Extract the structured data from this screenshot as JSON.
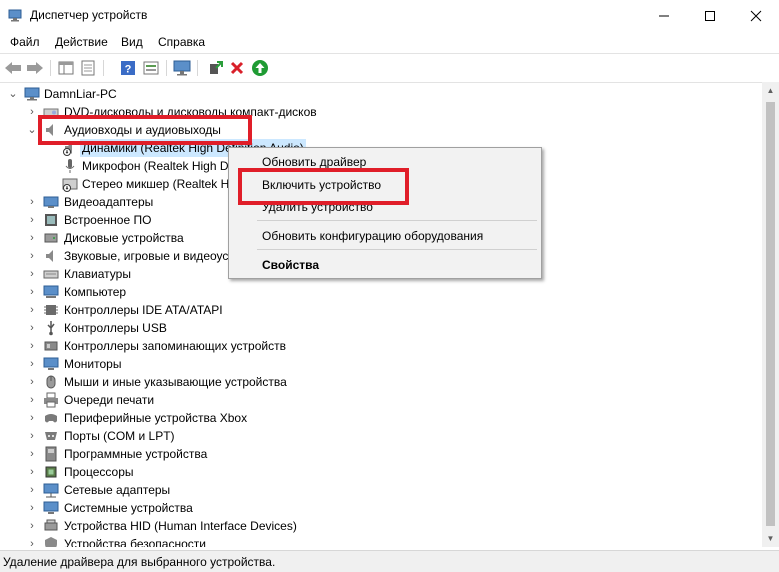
{
  "window": {
    "title": "Диспетчер устройств",
    "controls": [
      "minimize-icon",
      "maximize-icon",
      "close-icon"
    ]
  },
  "menu": [
    "Файл",
    "Действие",
    "Вид",
    "Справка"
  ],
  "toolbar": {
    "icons": [
      "back-arrow-icon",
      "forward-arrow-icon",
      "device-manager-view-icon",
      "properties-icon",
      "help-icon",
      "resources-view-icon",
      "scan-hardware-icon",
      "update-driver-icon",
      "remove-device-icon",
      "enable-device-icon"
    ]
  },
  "tree": {
    "root": "DamnLiar-PC",
    "rows": [
      {
        "label": "DVD-дисководы и дисководы компакт-дисков",
        "expander": "›",
        "icon": "dvd-drive-icon"
      },
      {
        "label": "Аудиовходы и аудиовыходы",
        "expander": "⌄",
        "icon": "speaker-icon"
      },
      {
        "label": "Динамики (Realtek High Definition Audio)",
        "expander": "",
        "icon": "speaker-device-disabled-icon"
      },
      {
        "label": "Микрофон (Realtek High D",
        "expander": "",
        "icon": "microphone-icon"
      },
      {
        "label": "Стерео микшер (Realtek H",
        "expander": "",
        "icon": "stereo-mixer-disabled-icon"
      },
      {
        "label": "Видеоадаптеры",
        "expander": "›",
        "icon": "display-adapter-icon"
      },
      {
        "label": "Встроенное ПО",
        "expander": "›",
        "icon": "firmware-icon"
      },
      {
        "label": "Дисковые устройства",
        "expander": "›",
        "icon": "disk-drive-icon"
      },
      {
        "label": "Звуковые, игровые и видеоус",
        "expander": "›",
        "icon": "sound-icon"
      },
      {
        "label": "Клавиатуры",
        "expander": "›",
        "icon": "keyboard-icon"
      },
      {
        "label": "Компьютер",
        "expander": "›",
        "icon": "computer-icon"
      },
      {
        "label": "Контроллеры IDE ATA/ATAPI",
        "expander": "›",
        "icon": "ide-controller-icon"
      },
      {
        "label": "Контроллеры USB",
        "expander": "›",
        "icon": "usb-icon"
      },
      {
        "label": "Контроллеры запоминающих устройств",
        "expander": "›",
        "icon": "storage-controller-icon"
      },
      {
        "label": "Мониторы",
        "expander": "›",
        "icon": "monitor-icon"
      },
      {
        "label": "Мыши и иные указывающие устройства",
        "expander": "›",
        "icon": "mouse-icon"
      },
      {
        "label": "Очереди печати",
        "expander": "›",
        "icon": "printer-icon"
      },
      {
        "label": "Периферийные устройства Xbox",
        "expander": "›",
        "icon": "xbox-peripheral-icon"
      },
      {
        "label": "Порты (COM и LPT)",
        "expander": "›",
        "icon": "port-icon"
      },
      {
        "label": "Программные устройства",
        "expander": "›",
        "icon": "software-device-icon"
      },
      {
        "label": "Процессоры",
        "expander": "›",
        "icon": "processor-icon"
      },
      {
        "label": "Сетевые адаптеры",
        "expander": "›",
        "icon": "network-adapter-icon"
      },
      {
        "label": "Системные устройства",
        "expander": "›",
        "icon": "system-device-icon"
      },
      {
        "label": "Устройства HID (Human Interface Devices)",
        "expander": "›",
        "icon": "hid-icon"
      },
      {
        "label": "Устройства безопасности",
        "expander": "›",
        "icon": "security-device-icon"
      }
    ]
  },
  "context_menu": {
    "items": [
      "Обновить драйвер",
      "Включить устройство",
      "Удалить устройство",
      "Обновить конфигурацию оборудования",
      "Свойства"
    ]
  },
  "status": "Удаление драйвера для выбранного устройства.",
  "colors": {
    "highlight": "#e01e29",
    "selection": "#cce8ff",
    "menu_bg": "#f2f2f2"
  }
}
